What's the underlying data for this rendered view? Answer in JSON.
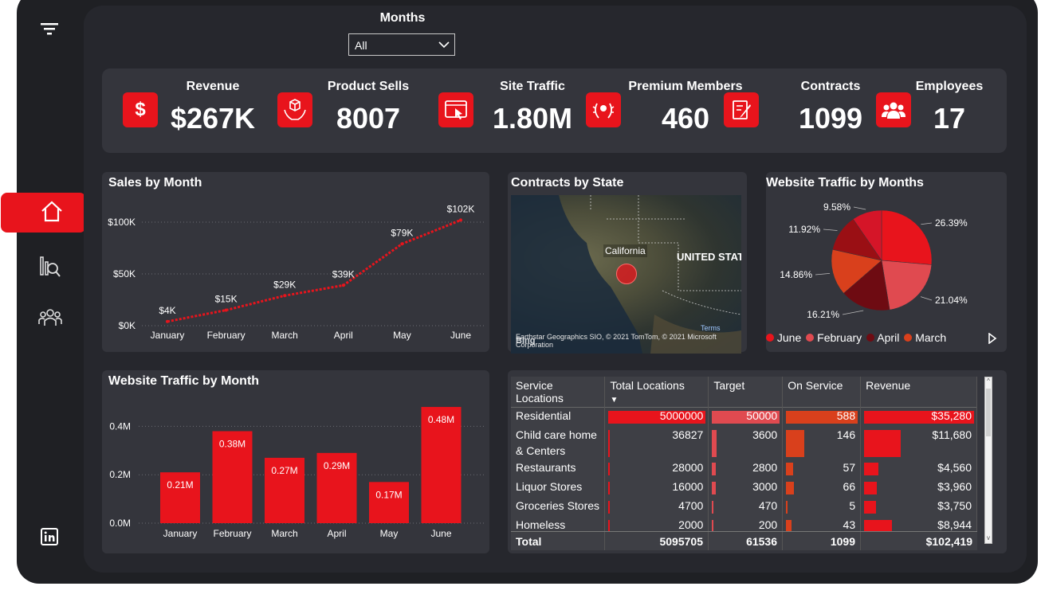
{
  "filter": {
    "label": "Months",
    "selected": "All"
  },
  "kpis": [
    {
      "label": "Revenue",
      "value": "$267K",
      "icon": "dollar-icon"
    },
    {
      "label": "Product Sells",
      "value": "8007",
      "icon": "box-hands-icon"
    },
    {
      "label": "Site Traffic",
      "value": "1.80M",
      "icon": "browser-click-icon"
    },
    {
      "label": "Premium Members",
      "value": "460",
      "icon": "laurel-icon"
    },
    {
      "label": "Contracts",
      "value": "1099",
      "icon": "contract-icon"
    },
    {
      "label": "Employees",
      "value": "17",
      "icon": "people-icon"
    }
  ],
  "sidebar": {
    "icons": [
      "filter-icon",
      "home-icon",
      "analytics-icon",
      "team-icon",
      "linkedin-icon"
    ]
  },
  "colors": {
    "accent": "#e8141c",
    "panel": "#34353c",
    "bg": "#26272d"
  },
  "sales_chart": {
    "title": "Sales by Month",
    "chart_data": {
      "type": "line",
      "categories": [
        "January",
        "February",
        "March",
        "April",
        "May",
        "June"
      ],
      "values": [
        4,
        15,
        29,
        39,
        79,
        102
      ],
      "labels": [
        "$4K",
        "$15K",
        "$29K",
        "$39K",
        "$79K",
        "$102K"
      ],
      "yticks": [
        "$0K",
        "$50K",
        "$100K"
      ],
      "ylim": [
        0,
        100
      ],
      "color": "#e8141c"
    }
  },
  "map": {
    "title": "Contracts by State",
    "label_state": "California",
    "label_country": "UNITED STAT",
    "attribution": "Earthstar Geographics SIO, © 2021 TomTom, © 2021 Microsoft Corporation",
    "bing": "Bing",
    "terms": "Terms"
  },
  "pie_chart": {
    "title": "Website Traffic by Months",
    "chart_data": {
      "type": "pie",
      "slices": [
        {
          "name": "June",
          "pct": 26.39,
          "label": "26.39%",
          "color": "#e8141c"
        },
        {
          "name": "February",
          "pct": 21.04,
          "label": "21.04%",
          "color": "#e04a50"
        },
        {
          "name": "April",
          "pct": 16.21,
          "label": "16.21%",
          "color": "#6e0b12"
        },
        {
          "name": "March",
          "pct": 14.86,
          "label": "14.86%",
          "color": "#d9401c"
        },
        {
          "name": "",
          "pct": 11.92,
          "label": "11.92%",
          "color": "#9a0f14"
        },
        {
          "name": "",
          "pct": 9.58,
          "label": "9.58%",
          "color": "#d51528"
        }
      ],
      "legend": [
        "June",
        "February",
        "April",
        "March"
      ]
    }
  },
  "bar_chart": {
    "title": "Website Traffic by Month",
    "chart_data": {
      "type": "bar",
      "categories": [
        "January",
        "February",
        "March",
        "April",
        "May",
        "June"
      ],
      "values": [
        0.21,
        0.38,
        0.27,
        0.29,
        0.17,
        0.48
      ],
      "labels": [
        "0.21M",
        "0.38M",
        "0.27M",
        "0.29M",
        "0.17M",
        "0.48M"
      ],
      "yticks": [
        "0.0M",
        "0.2M",
        "0.4M"
      ],
      "ylim": [
        0,
        0.5
      ],
      "color": "#e8141c"
    }
  },
  "table": {
    "columns": [
      "Service Locations",
      "Total Locations",
      "Target",
      "On Service",
      "Revenue"
    ],
    "rows": [
      {
        "name": "Residential",
        "total": "5000000",
        "target": "50000",
        "onservice": "588",
        "revenue": "$35,280",
        "t": 5000000,
        "tg": 50000,
        "os": 588,
        "rv": 35280
      },
      {
        "name": "Child care home & Centers",
        "total": "36827",
        "target": "3600",
        "onservice": "146",
        "revenue": "$11,680",
        "t": 36827,
        "tg": 3600,
        "os": 146,
        "rv": 11680
      },
      {
        "name": "Restaurants",
        "total": "28000",
        "target": "2800",
        "onservice": "57",
        "revenue": "$4,560",
        "t": 28000,
        "tg": 2800,
        "os": 57,
        "rv": 4560
      },
      {
        "name": "Liquor Stores",
        "total": "16000",
        "target": "3000",
        "onservice": "66",
        "revenue": "$3,960",
        "t": 16000,
        "tg": 3000,
        "os": 66,
        "rv": 3960
      },
      {
        "name": "Groceries Stores",
        "total": "4700",
        "target": "470",
        "onservice": "5",
        "revenue": "$3,750",
        "t": 4700,
        "tg": 470,
        "os": 5,
        "rv": 3750
      },
      {
        "name": "Homeless",
        "total": "2000",
        "target": "200",
        "onservice": "43",
        "revenue": "$8,944",
        "t": 2000,
        "tg": 200,
        "os": 43,
        "rv": 8944
      }
    ],
    "total": {
      "name": "Total",
      "total": "5095705",
      "target": "61536",
      "onservice": "1099",
      "revenue": "$102,419"
    }
  }
}
